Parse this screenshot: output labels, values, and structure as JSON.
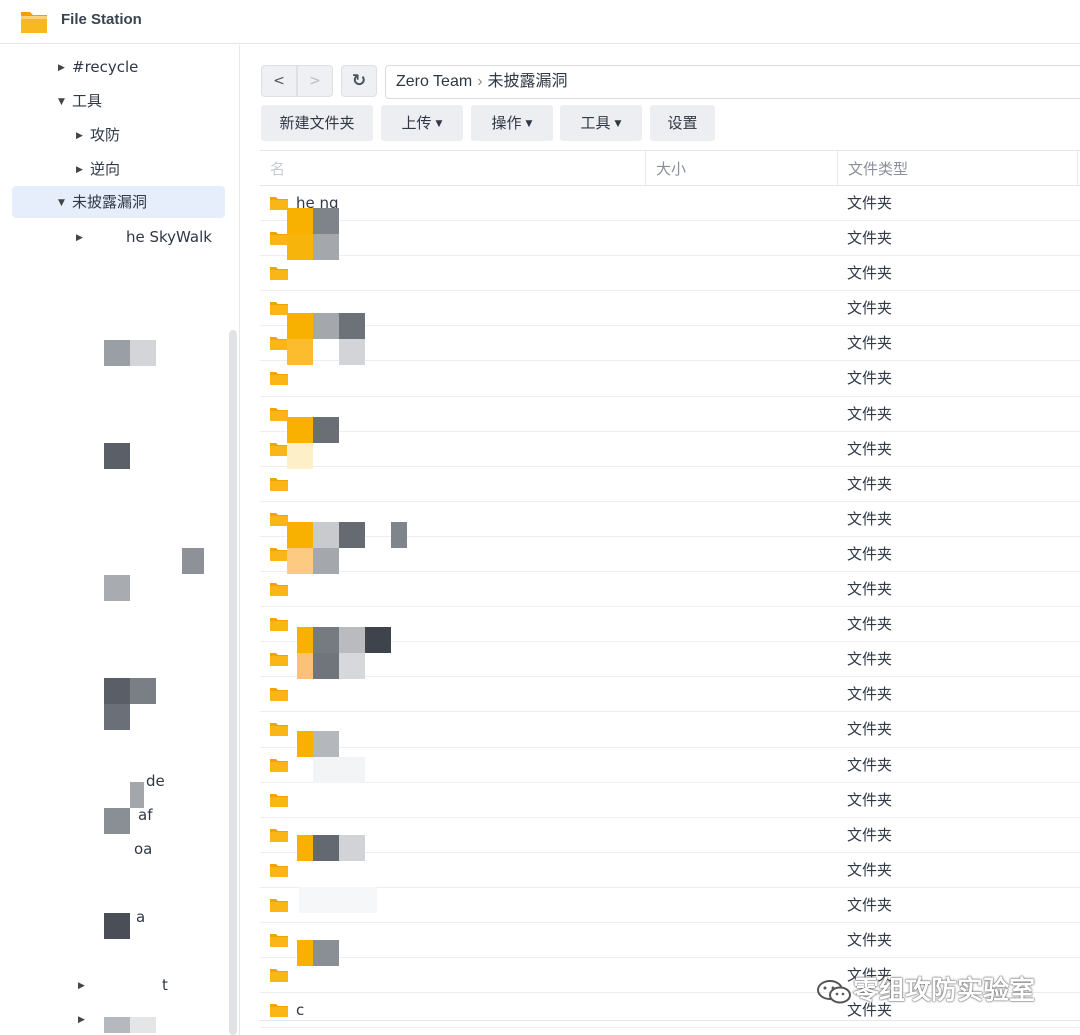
{
  "window": {
    "title": "File Station"
  },
  "sidebar": {
    "items": [
      {
        "label": "#recycle"
      },
      {
        "label": "工具"
      },
      {
        "label": "攻防"
      },
      {
        "label": "逆向"
      },
      {
        "label": "未披露漏洞"
      },
      {
        "label": "he SkyWalk"
      },
      {
        "label": "de"
      },
      {
        "label": "af"
      },
      {
        "label": "oa"
      },
      {
        "label": "a"
      },
      {
        "label": "t"
      }
    ]
  },
  "toolbar": {
    "back_label": "<",
    "forward_label": ">",
    "refresh_label": "↻",
    "path": {
      "root": "Zero Team",
      "separator": "›",
      "current": "未披露漏洞"
    },
    "buttons": {
      "new_folder": "新建文件夹",
      "upload": "上传",
      "action": "操作",
      "tools": "工具",
      "settings": "设置"
    }
  },
  "table": {
    "columns": {
      "name": "名",
      "size": "大小",
      "type": "文件类型"
    },
    "rows": [
      {
        "name": "he            ng",
        "type": "文件夹"
      },
      {
        "name": "",
        "type": "文件夹"
      },
      {
        "name": "",
        "type": "文件夹"
      },
      {
        "name": "",
        "type": "文件夹"
      },
      {
        "name": "",
        "type": "文件夹"
      },
      {
        "name": "",
        "type": "文件夹"
      },
      {
        "name": "",
        "type": "文件夹"
      },
      {
        "name": "",
        "type": "文件夹"
      },
      {
        "name": "",
        "type": "文件夹"
      },
      {
        "name": "",
        "type": "文件夹"
      },
      {
        "name": "",
        "type": "文件夹"
      },
      {
        "name": "",
        "type": "文件夹"
      },
      {
        "name": "",
        "type": "文件夹"
      },
      {
        "name": "",
        "type": "文件夹"
      },
      {
        "name": "",
        "type": "文件夹"
      },
      {
        "name": "",
        "type": "文件夹"
      },
      {
        "name": "",
        "type": "文件夹"
      },
      {
        "name": "",
        "type": "文件夹"
      },
      {
        "name": "",
        "type": "文件夹"
      },
      {
        "name": "",
        "type": "文件夹"
      },
      {
        "name": "",
        "type": "文件夹"
      },
      {
        "name": "",
        "type": "文件夹"
      },
      {
        "name": "",
        "type": "文件夹"
      },
      {
        "name": "c",
        "type": "文件夹"
      }
    ]
  },
  "watermark": {
    "text": "零组攻防实验室"
  },
  "colors": {
    "folder": "#f5b000",
    "selected_bg": "#e6eefb",
    "accent": "#2d6be4"
  }
}
